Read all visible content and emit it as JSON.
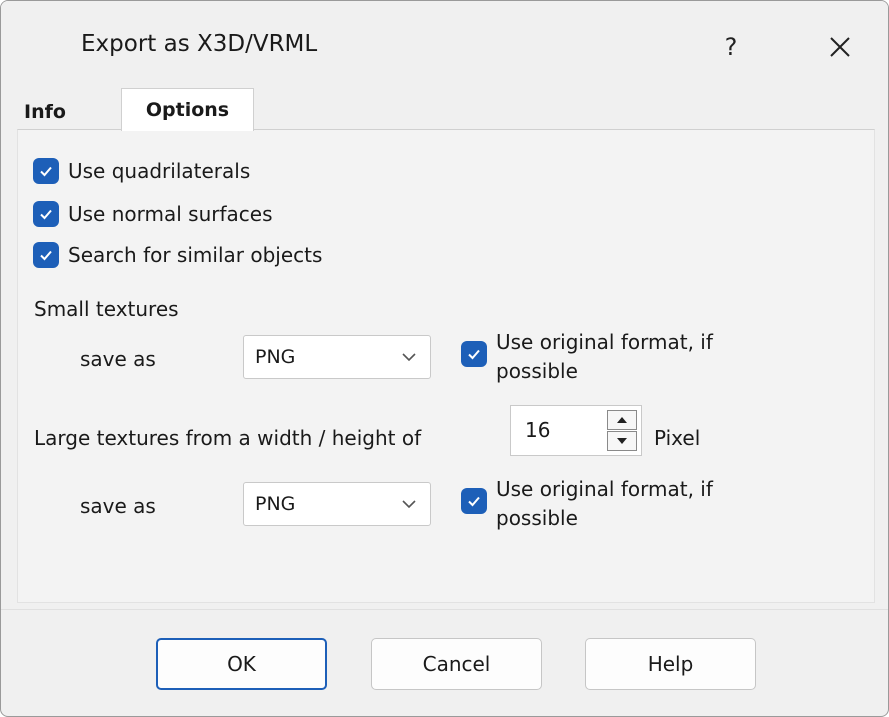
{
  "window": {
    "title": "Export as X3D/VRML",
    "help_glyph": "?",
    "close_icon": "close-icon"
  },
  "tabs": [
    {
      "label": "Info",
      "active": false
    },
    {
      "label": "Options",
      "active": true
    }
  ],
  "options": {
    "use_quadrilaterals": {
      "label": "Use quadrilaterals",
      "checked": true
    },
    "use_normal_surfaces": {
      "label": "Use normal surfaces",
      "checked": true
    },
    "search_similar": {
      "label": "Search for similar objects",
      "checked": true
    }
  },
  "small_textures": {
    "heading": "Small textures",
    "save_as_label": "save as",
    "format": "PNG",
    "use_original": {
      "label": "Use original format, if possible",
      "checked": true
    }
  },
  "large_textures": {
    "heading": "Large textures from a width / height of",
    "threshold": "16",
    "unit": "Pixel",
    "save_as_label": "save as",
    "format": "PNG",
    "use_original": {
      "label": "Use original format, if possible",
      "checked": true
    }
  },
  "buttons": {
    "ok": "OK",
    "cancel": "Cancel",
    "help": "Help"
  },
  "colors": {
    "accent": "#1d5fb8",
    "background": "#f0f0f0"
  }
}
